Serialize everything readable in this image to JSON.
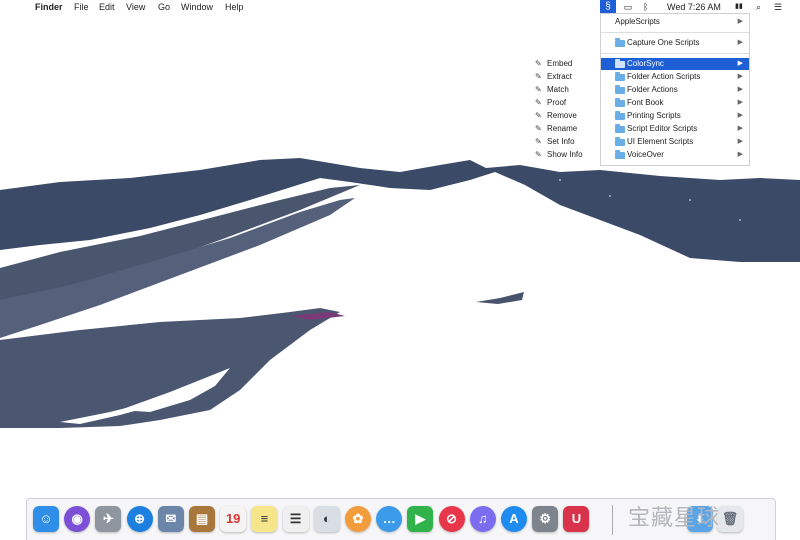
{
  "menubar": {
    "app_name": "Finder",
    "menus": [
      "File",
      "Edit",
      "View",
      "Go",
      "Window",
      "Help"
    ],
    "clock": "Wed 7:26 AM"
  },
  "script_menu": {
    "items": [
      {
        "label": "AppleScripts",
        "submenu": true
      },
      {
        "label": "Capture One Scripts",
        "submenu": true
      },
      {
        "label": "ColorSync",
        "submenu": true,
        "highlighted": true
      },
      {
        "label": "Folder Action Scripts",
        "submenu": true
      },
      {
        "label": "Folder Actions",
        "submenu": true
      },
      {
        "label": "Font Book",
        "submenu": true
      },
      {
        "label": "Printing Scripts",
        "submenu": true
      },
      {
        "label": "Script Editor Scripts",
        "submenu": true
      },
      {
        "label": "UI Element Scripts",
        "submenu": true
      },
      {
        "label": "VoiceOver",
        "submenu": true
      }
    ]
  },
  "finder_menu": {
    "items": [
      "Embed",
      "Extract",
      "Match",
      "Proof",
      "Remove",
      "Rename",
      "Set Info",
      "Show Info"
    ]
  },
  "dock": {
    "apps": [
      {
        "name": "Finder",
        "icon": "finder-icon",
        "glyph": "☺",
        "color": "#2f8fe8"
      },
      {
        "name": "Siri",
        "icon": "siri-icon",
        "glyph": "◉",
        "color": "#7b4fd6"
      },
      {
        "name": "Launchpad",
        "icon": "launchpad-icon",
        "glyph": "✈",
        "color": "#8f96a0"
      },
      {
        "name": "Safari",
        "icon": "safari-icon",
        "glyph": "⊕",
        "color": "#1d7fe0"
      },
      {
        "name": "Mail",
        "icon": "mail-icon",
        "glyph": "✉",
        "color": "#6b86a8"
      },
      {
        "name": "Notes Book",
        "icon": "notebook-icon",
        "glyph": "▤",
        "color": "#a9763c"
      },
      {
        "name": "Calendar",
        "icon": "calendar-icon",
        "glyph": "19",
        "color": "#f4f4f4"
      },
      {
        "name": "Notes",
        "icon": "notes-icon",
        "glyph": "≡",
        "color": "#f6e58a"
      },
      {
        "name": "Reminders",
        "icon": "reminders-icon",
        "glyph": "☰",
        "color": "#f0f0f0"
      },
      {
        "name": "Photo Booth",
        "icon": "photo-booth-icon",
        "glyph": "◐",
        "color": "#d9dde4"
      },
      {
        "name": "Photos",
        "icon": "photos-icon",
        "glyph": "✿",
        "color": "#f39c3c"
      },
      {
        "name": "Messages",
        "icon": "messages-icon",
        "glyph": "…",
        "color": "#3b9be8"
      },
      {
        "name": "FaceTime",
        "icon": "facetime-icon",
        "glyph": "▶",
        "color": "#30b34a"
      },
      {
        "name": "News",
        "icon": "news-icon",
        "glyph": "⊘",
        "color": "#e8374a"
      },
      {
        "name": "iTunes",
        "icon": "itunes-icon",
        "glyph": "♫",
        "color": "#7c6df0"
      },
      {
        "name": "App Store",
        "icon": "app-store-icon",
        "glyph": "A",
        "color": "#1f8bf0"
      },
      {
        "name": "System Preferences",
        "icon": "system-preferences-icon",
        "glyph": "⚙",
        "color": "#7e848d"
      },
      {
        "name": "Magnet",
        "icon": "magnet-icon",
        "glyph": "U",
        "color": "#d8334a"
      }
    ],
    "right_items": [
      {
        "name": "Downloads",
        "icon": "downloads-icon"
      },
      {
        "name": "Trash",
        "icon": "trash-icon"
      }
    ],
    "watermark": "宝藏星球"
  }
}
